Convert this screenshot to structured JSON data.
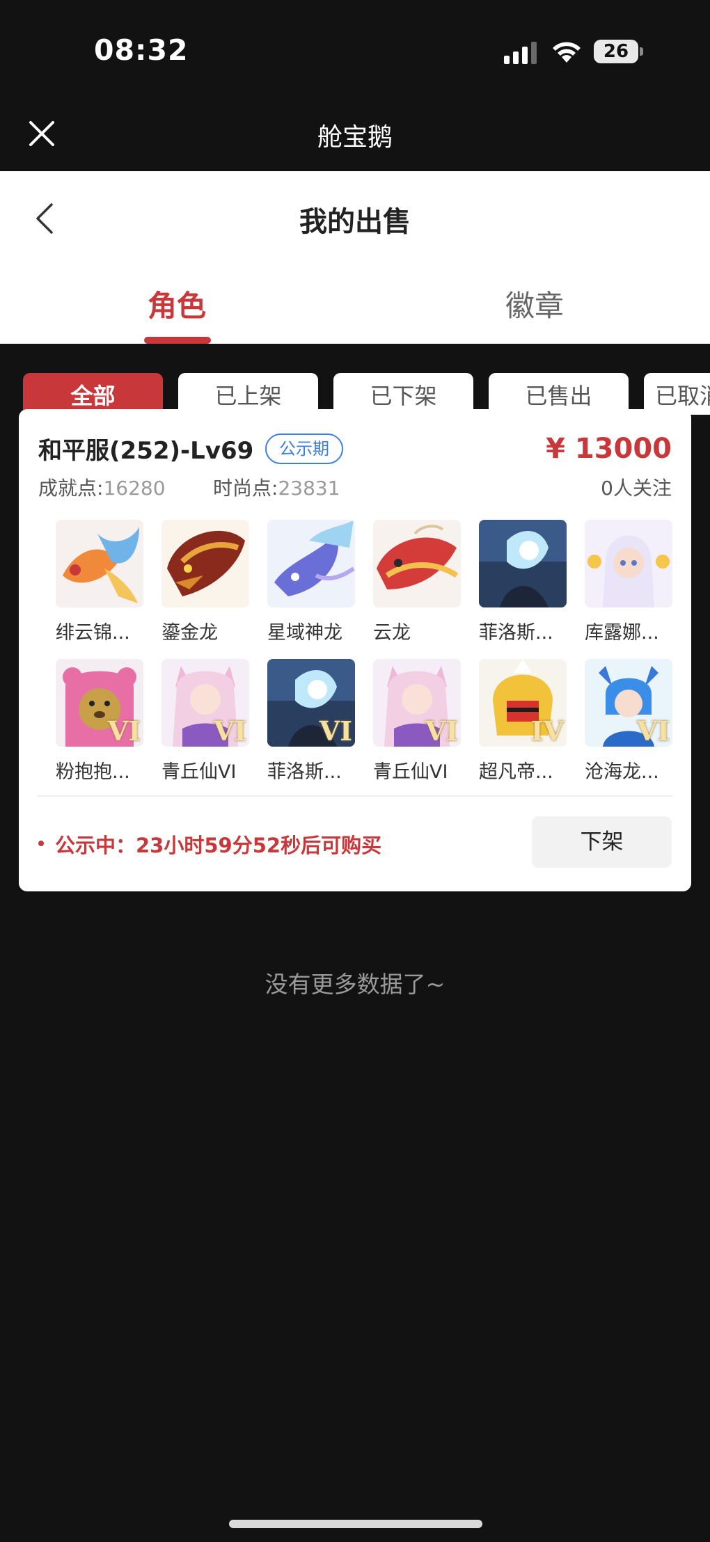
{
  "status_bar": {
    "time": "08:32",
    "battery": "26"
  },
  "app": {
    "title": "舱宝鹅"
  },
  "page": {
    "title": "我的出售"
  },
  "tabs": [
    {
      "label": "角色",
      "active": true
    },
    {
      "label": "徽章",
      "active": false
    }
  ],
  "filters": [
    {
      "label": "全部",
      "active": true
    },
    {
      "label": "已上架",
      "active": false
    },
    {
      "label": "已下架",
      "active": false
    },
    {
      "label": "已售出",
      "active": false
    },
    {
      "label": "已取消",
      "active": false
    }
  ],
  "listing": {
    "title": "和平服(252)-Lv69",
    "badge": "公示期",
    "price": "¥ 13000",
    "achievement_label": "成就点:",
    "achievement_value": "16280",
    "fashion_label": "时尚点:",
    "fashion_value": "23831",
    "followers": "0人关注",
    "items": [
      {
        "name": "绯云锦...",
        "tier": ""
      },
      {
        "name": "鎏金龙",
        "tier": ""
      },
      {
        "name": "星域神龙",
        "tier": ""
      },
      {
        "name": "云龙",
        "tier": ""
      },
      {
        "name": "菲洛斯...",
        "tier": ""
      },
      {
        "name": "库露娜...",
        "tier": ""
      },
      {
        "name": "粉抱抱...",
        "tier": "VI"
      },
      {
        "name": "青丘仙VI",
        "tier": "VI"
      },
      {
        "name": "菲洛斯...",
        "tier": "VI"
      },
      {
        "name": "青丘仙VI",
        "tier": "VI"
      },
      {
        "name": "超凡帝...",
        "tier": "IV"
      },
      {
        "name": "沧海龙...",
        "tier": "VI"
      }
    ],
    "notice": "公示中：23小时59分52秒后可购买",
    "delist_label": "下架"
  },
  "footer": {
    "no_more": "没有更多数据了~"
  },
  "colors": {
    "accent": "#c8373a",
    "badge_blue": "#3c7ee3",
    "background": "#121213"
  }
}
